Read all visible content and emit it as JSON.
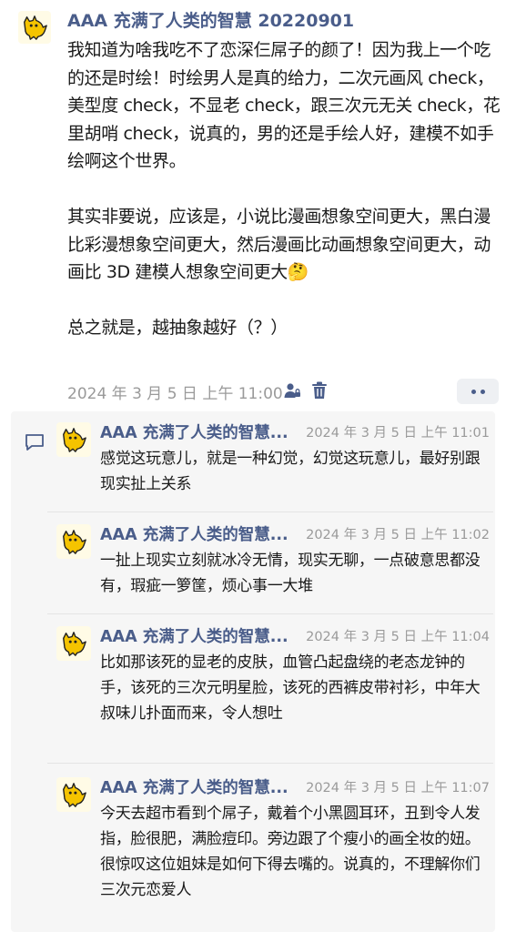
{
  "post": {
    "author": "AAA 充满了人类的智慧 20220901",
    "paragraphs": [
      "我知道为啥我吃不了恋深仨屌子的颜了！因为我上一个吃的还是时绘！时绘男人是真的给力，二次元画风 check，美型度 check，不显老 check，跟三次元无关 check，花里胡哨 check，说真的，男的还是手绘人好，建模不如手绘啊这个世界。",
      "其实非要说，应该是，小说比漫画想象空间更大，黑白漫比彩漫想象空间更大，然后漫画比动画想象空间更大，动画比 3D 建模人想象空间更大🤔",
      "总之就是，越抽象越好（？）"
    ],
    "time": "2024 年 3 月 5 日 上午 11:00",
    "icons": {
      "visibility": "person-lock-icon",
      "delete": "trash-icon",
      "more": "more-icon"
    }
  },
  "comments": {
    "icon": "comment-icon",
    "items": [
      {
        "author": "AAA 充满了人类的智慧...",
        "time": "2024 年 3 月 5 日 上午 11:01",
        "text": "感觉这玩意儿，就是一种幻觉，幻觉这玩意儿，最好别跟现实扯上关系"
      },
      {
        "author": "AAA 充满了人类的智慧...",
        "time": "2024 年 3 月 5 日 上午 11:02",
        "text": "一扯上现实立刻就冰冷无情，现实无聊，一点破意思都没有，瑕疵一箩筐，烦心事一大堆"
      },
      {
        "author": "AAA 充满了人类的智慧...",
        "time": "2024 年 3 月 5 日 上午 11:04",
        "text": "比如那该死的显老的皮肤，血管凸起盘绕的老态龙钟的手，该死的三次元明星脸，该死的西裤皮带衬衫，中年大叔味儿扑面而来，令人想吐"
      },
      {
        "author": "AAA 充满了人类的智慧...",
        "time": "2024 年 3 月 5 日 上午 11:07",
        "text": "今天去超市看到个屌子，戴着个小黑圆耳环，丑到令人发指，脸很肥，满脸痘印。旁边跟了个瘦小的画全妆的妞。很惊叹这位姐妹是如何下得去嘴的。说真的，不理解你们三次元恋爱人"
      }
    ]
  },
  "colors": {
    "link": "#4a5d8a",
    "meta": "#9a9a9a",
    "comment_bg": "#f6f6f6"
  }
}
